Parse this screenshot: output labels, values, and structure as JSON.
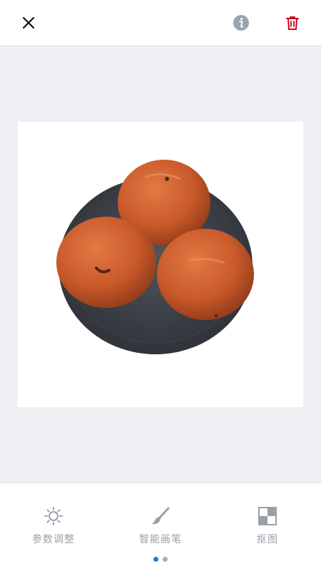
{
  "header": {
    "close_icon": "close-icon",
    "info_icon": "info-icon",
    "delete_icon": "trash-icon",
    "colors": {
      "info": "#9aa3b2",
      "delete": "#d0021b",
      "close": "#111111"
    }
  },
  "photo": {
    "subject": "three-buns-on-dark-plate"
  },
  "toolbar": {
    "tools": [
      {
        "label": "参数调整",
        "icon": "sun-adjust-icon"
      },
      {
        "label": "智能画笔",
        "icon": "brush-icon"
      },
      {
        "label": "抠图",
        "icon": "cutout-icon"
      }
    ],
    "page_dots": {
      "count": 2,
      "active": 1
    },
    "colors": {
      "icon": "#9aa0aa",
      "label": "#9aa0aa",
      "dot_active": "#2f6fe4",
      "dot_inactive": "#a7adb8"
    }
  }
}
